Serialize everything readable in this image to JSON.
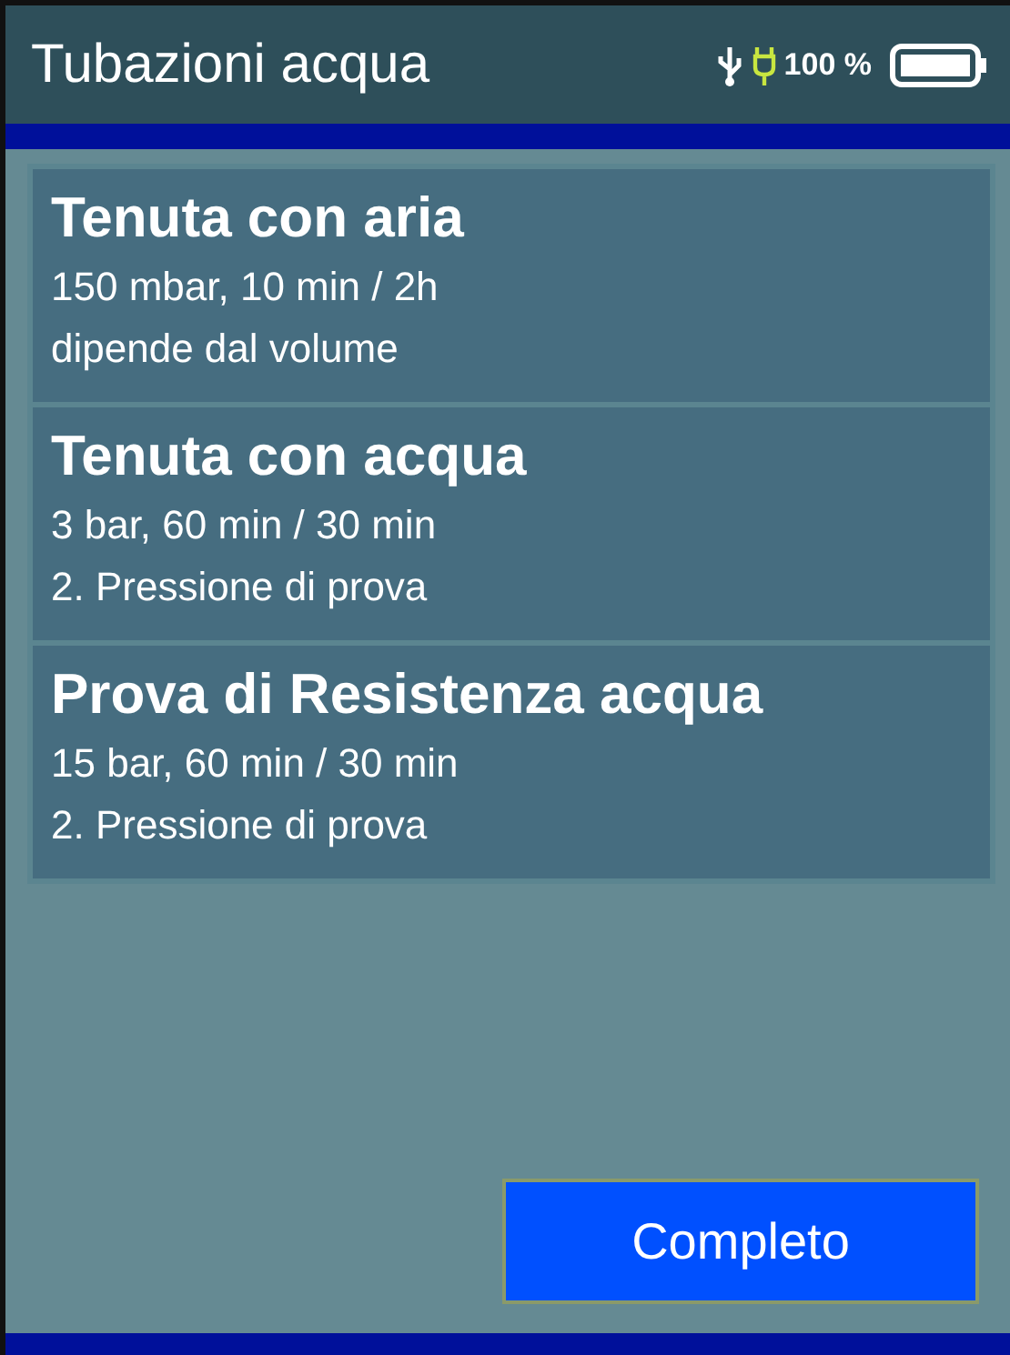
{
  "header": {
    "title": "Tubazioni acqua",
    "battery_text": "100 %"
  },
  "tests": [
    {
      "title": "Tenuta con aria",
      "lines": [
        "150 mbar, 10 min / 2h",
        "dipende dal volume"
      ]
    },
    {
      "title": "Tenuta con acqua",
      "lines": [
        "3 bar, 60 min / 30 min",
        "2. Pressione di prova"
      ]
    },
    {
      "title": "Prova di Resistenza acqua",
      "lines": [
        "15 bar, 60 min / 30 min",
        "2. Pressione di prova"
      ]
    }
  ],
  "buttons": [
    {
      "label": "Completo"
    }
  ]
}
